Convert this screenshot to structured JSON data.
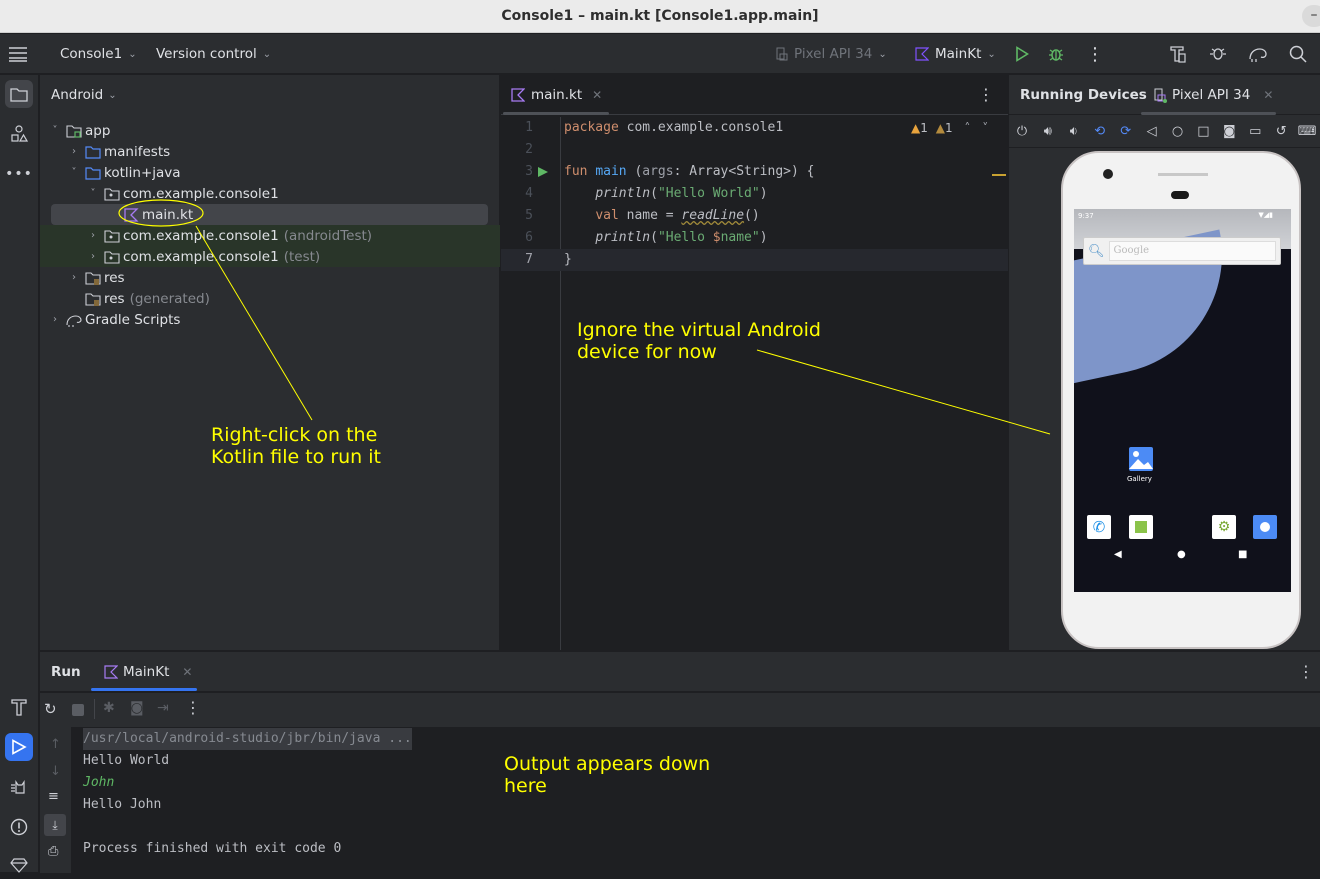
{
  "window": {
    "title": "Console1 – main.kt [Console1.app.main]",
    "minimize_label": "–"
  },
  "toolbar": {
    "project": "Console1",
    "vcs": "Version control",
    "device": "Pixel API 34",
    "run_config": "MainKt"
  },
  "project_panel": {
    "view_mode": "Android",
    "tree": [
      {
        "label": "app",
        "suffix": "",
        "arrow": "˅",
        "icon": "module-folder-icon"
      },
      {
        "label": "manifests",
        "suffix": "",
        "arrow": "›",
        "icon": "folder-icon"
      },
      {
        "label": "kotlin+java",
        "suffix": "",
        "arrow": "˅",
        "icon": "folder-icon"
      },
      {
        "label": "com.example.console1",
        "suffix": "",
        "arrow": "˅",
        "icon": "package-icon"
      },
      {
        "label": "main.kt",
        "suffix": "",
        "arrow": "",
        "icon": "kotlin-file-icon"
      },
      {
        "label": "com.example.console1",
        "suffix": "(androidTest)",
        "arrow": "›",
        "icon": "package-icon"
      },
      {
        "label": "com.example.console1",
        "suffix": "(test)",
        "arrow": "›",
        "icon": "package-icon"
      },
      {
        "label": "res",
        "suffix": "",
        "arrow": "›",
        "icon": "res-folder-icon"
      },
      {
        "label": "res",
        "suffix": "(generated)",
        "arrow": "",
        "icon": "res-folder-icon"
      },
      {
        "label": "Gradle Scripts",
        "suffix": "",
        "arrow": "›",
        "icon": "gradle-icon"
      }
    ]
  },
  "editor": {
    "tab": "main.kt",
    "warnings": [
      "1",
      "1"
    ],
    "line_numbers": [
      "1",
      "2",
      "3",
      "4",
      "5",
      "6",
      "7"
    ],
    "lines": {
      "l1_kw": "package",
      "l1_rest": " com.example.console1",
      "l3_kw": "fun",
      "l3_fn": "main",
      "l3_a": " (",
      "l3_param": "args",
      "l3_b": ": Array<String>) {",
      "l4_fn": "println",
      "l4_a": "(",
      "l4_str": "\"Hello World\"",
      "l4_b": ")",
      "l5_kw": "val",
      "l5_a": " name = ",
      "l5_fn": "readLine",
      "l5_b": "()",
      "l6_fn": "println",
      "l6_a": "(",
      "l6_str1": "\"Hello ",
      "l6_var": "$",
      "l6_str2": "name\"",
      "l6_b": ")",
      "l7": "}"
    }
  },
  "devices": {
    "title": "Running Devices",
    "tab": "Pixel API 34",
    "phone": {
      "time": "9:37",
      "search_placeholder": "Google",
      "gallery_label": "Gallery"
    }
  },
  "run_panel": {
    "title": "Run",
    "tab": "MainKt",
    "output": [
      "/usr/local/android-studio/jbr/bin/java ...",
      "Hello World",
      "John",
      "Hello John",
      "",
      "Process finished with exit code 0"
    ]
  },
  "annotations": {
    "right_click": "Right-click on the\nKotlin file to run it",
    "ignore_device": "Ignore the virtual Android\ndevice for now",
    "output_here": "Output appears down\nhere"
  },
  "colors": {
    "accent": "#3574f0",
    "annotation": "#ffff00",
    "run_green": "#5fb865"
  }
}
